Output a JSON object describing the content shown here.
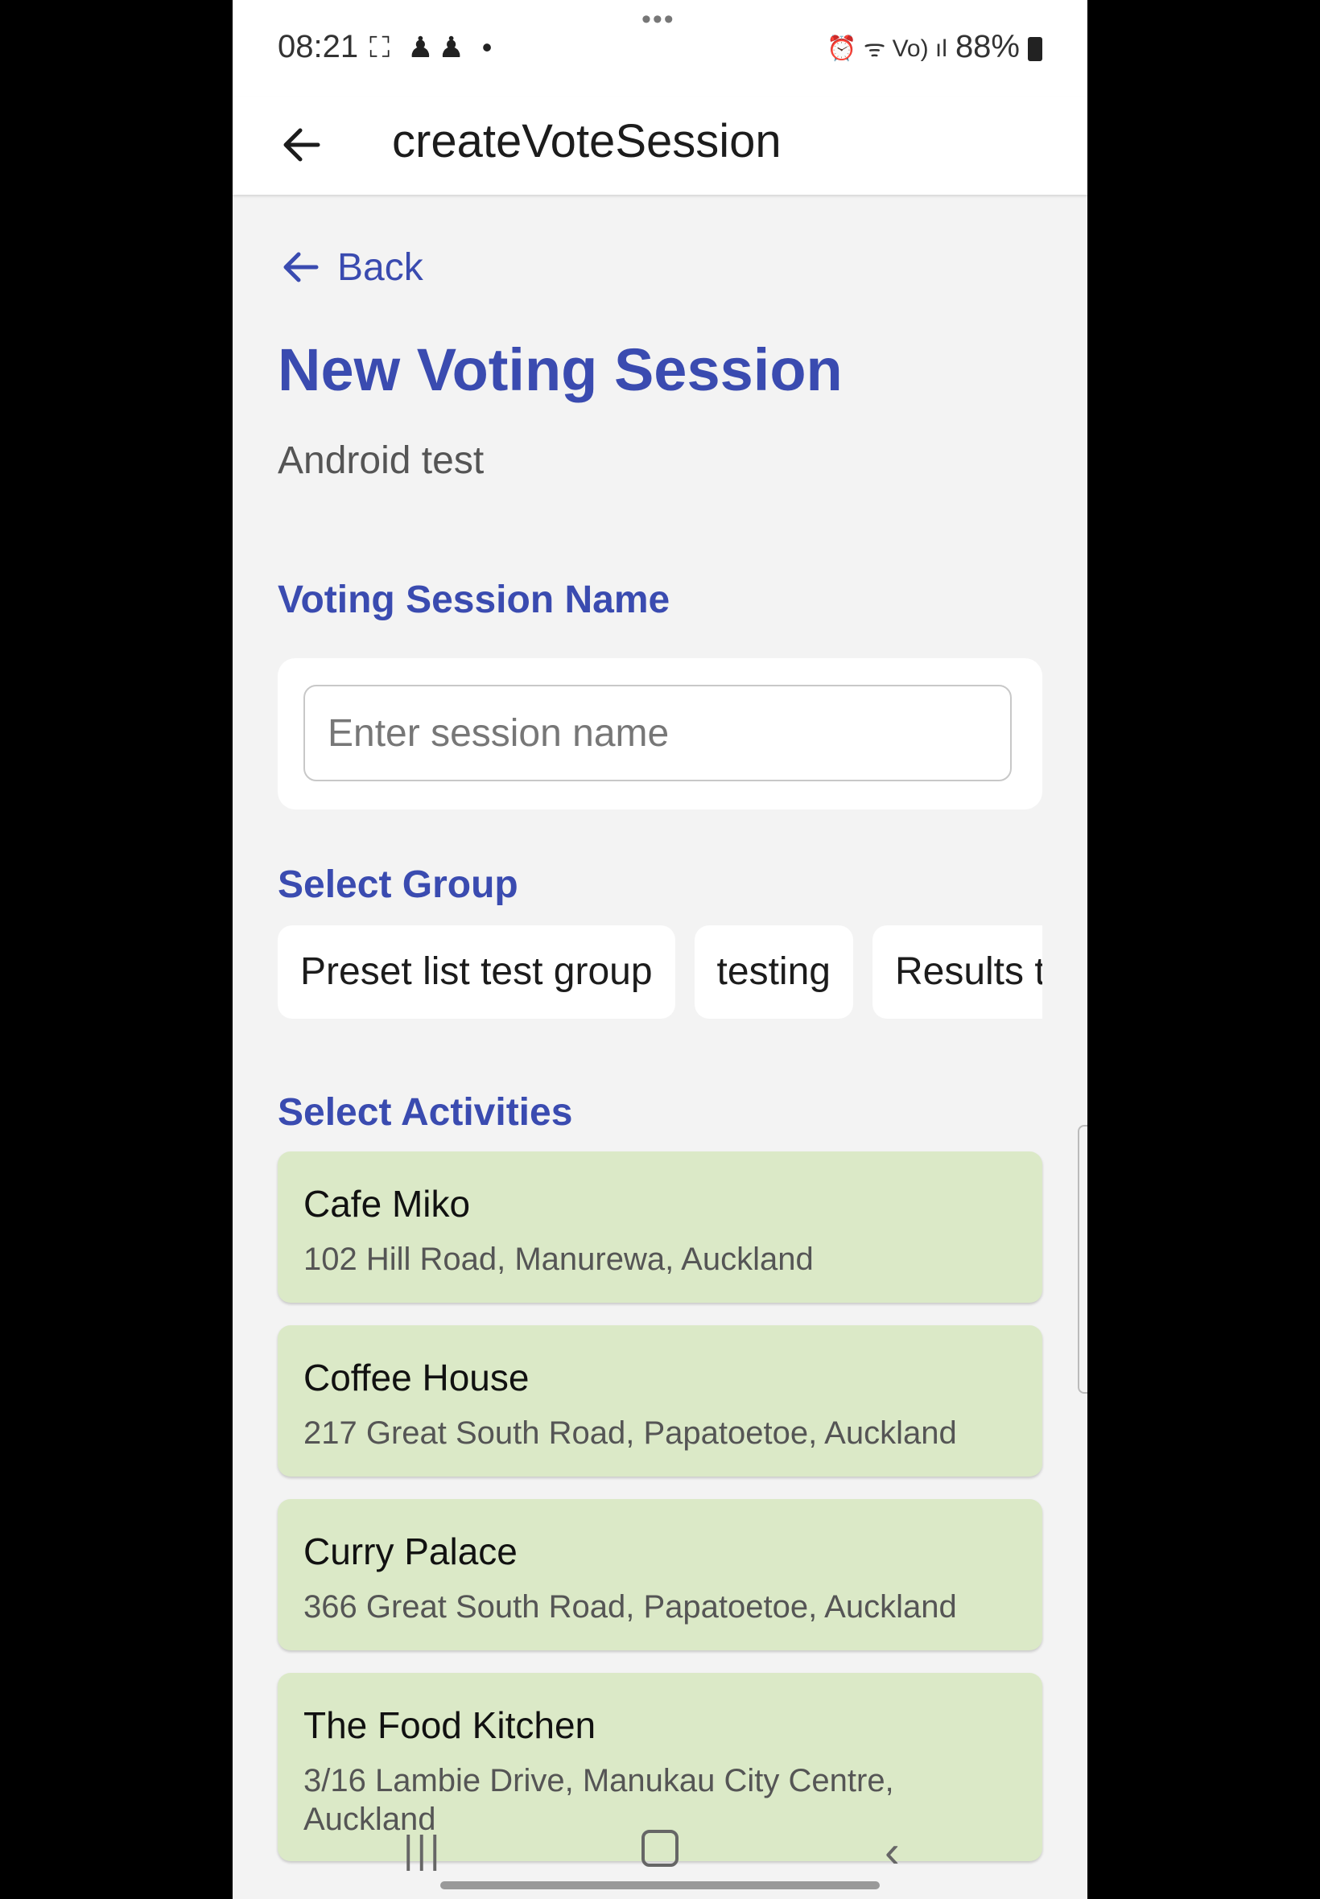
{
  "status_bar": {
    "time": "08:21",
    "left_icons": "⛶ ♟♟ •",
    "right_icons": "⏰ ᯤ Vo) ıl",
    "battery": "88%"
  },
  "app_bar": {
    "title": "createVoteSession"
  },
  "back_link": {
    "label": "Back"
  },
  "page": {
    "title": "New Voting Session",
    "subtitle": "Android test"
  },
  "session_name": {
    "label": "Voting Session Name",
    "placeholder": "Enter session name",
    "value": ""
  },
  "groups": {
    "label": "Select Group",
    "items": [
      "Preset list test group",
      "testing",
      "Results test"
    ]
  },
  "activities": {
    "label": "Select Activities",
    "items": [
      {
        "name": "Cafe Miko",
        "address": "102 Hill Road, Manurewa, Auckland"
      },
      {
        "name": "Coffee House",
        "address": "217 Great South Road, Papatoetoe, Auckland"
      },
      {
        "name": "Curry Palace",
        "address": "366 Great South Road, Papatoetoe, Auckland"
      },
      {
        "name": "The Food Kitchen",
        "address": "3/16 Lambie Drive, Manukau City Centre, Auckland"
      }
    ]
  },
  "nav": {
    "recents": "|||",
    "back": "‹"
  },
  "colors": {
    "accent": "#3a4bb0",
    "activity_bg": "#dbe9c7",
    "background": "#f3f3f3"
  }
}
